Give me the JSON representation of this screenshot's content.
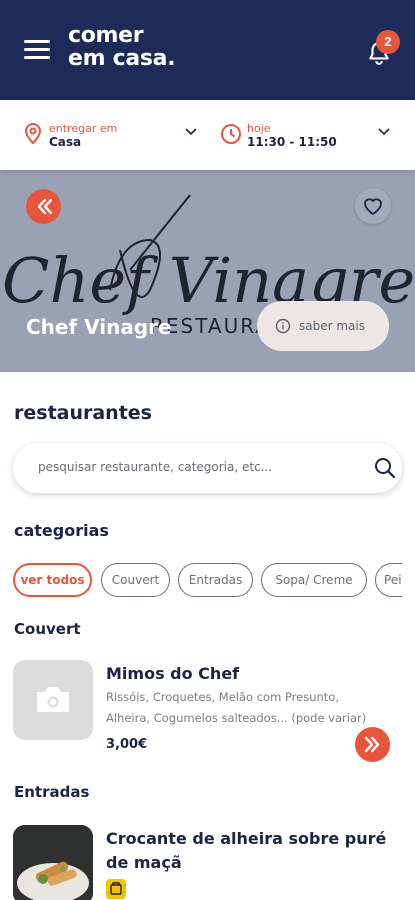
{
  "header": {
    "logo_line1": "comer",
    "logo_line2": "em casa.",
    "notification_count": "2"
  },
  "delivery": {
    "location_label": "entregar em",
    "location_value": "Casa",
    "time_label": "hoje",
    "time_value": "11:30 - 11:50"
  },
  "hero": {
    "title": "Chef Vinagre",
    "know_more": "saber mais",
    "art_text_large": "Chef Vinagre",
    "art_text_small": "RESTAURANTE"
  },
  "restaurants": {
    "title": "restaurantes",
    "search_placeholder": "pesquisar restaurante, categoria, etc..."
  },
  "categories": {
    "title": "categorias",
    "chips": [
      {
        "label": "ver todos",
        "active": true
      },
      {
        "label": "Couvert",
        "active": false
      },
      {
        "label": "Entradas",
        "active": false
      },
      {
        "label": "Sopa/ Creme",
        "active": false
      },
      {
        "label": "Pei",
        "active": false
      }
    ]
  },
  "groups": [
    {
      "title": "Couvert",
      "items": [
        {
          "name": "Mimos do Chef",
          "desc_line1": "Rissóis, Croquetes, Melão com Presunto,",
          "desc_line2": "Alheira, Cogumelos salteados... (pode variar)",
          "price": "3,00€"
        }
      ]
    },
    {
      "title": "Entradas",
      "items": [
        {
          "name_line1": "Crocante de alheira sobre puré",
          "name_line2": "de maçã"
        }
      ]
    }
  ],
  "colors": {
    "header_bg": "#1e2a58",
    "accent": "#e8553d",
    "text_dark": "#1b2447"
  }
}
